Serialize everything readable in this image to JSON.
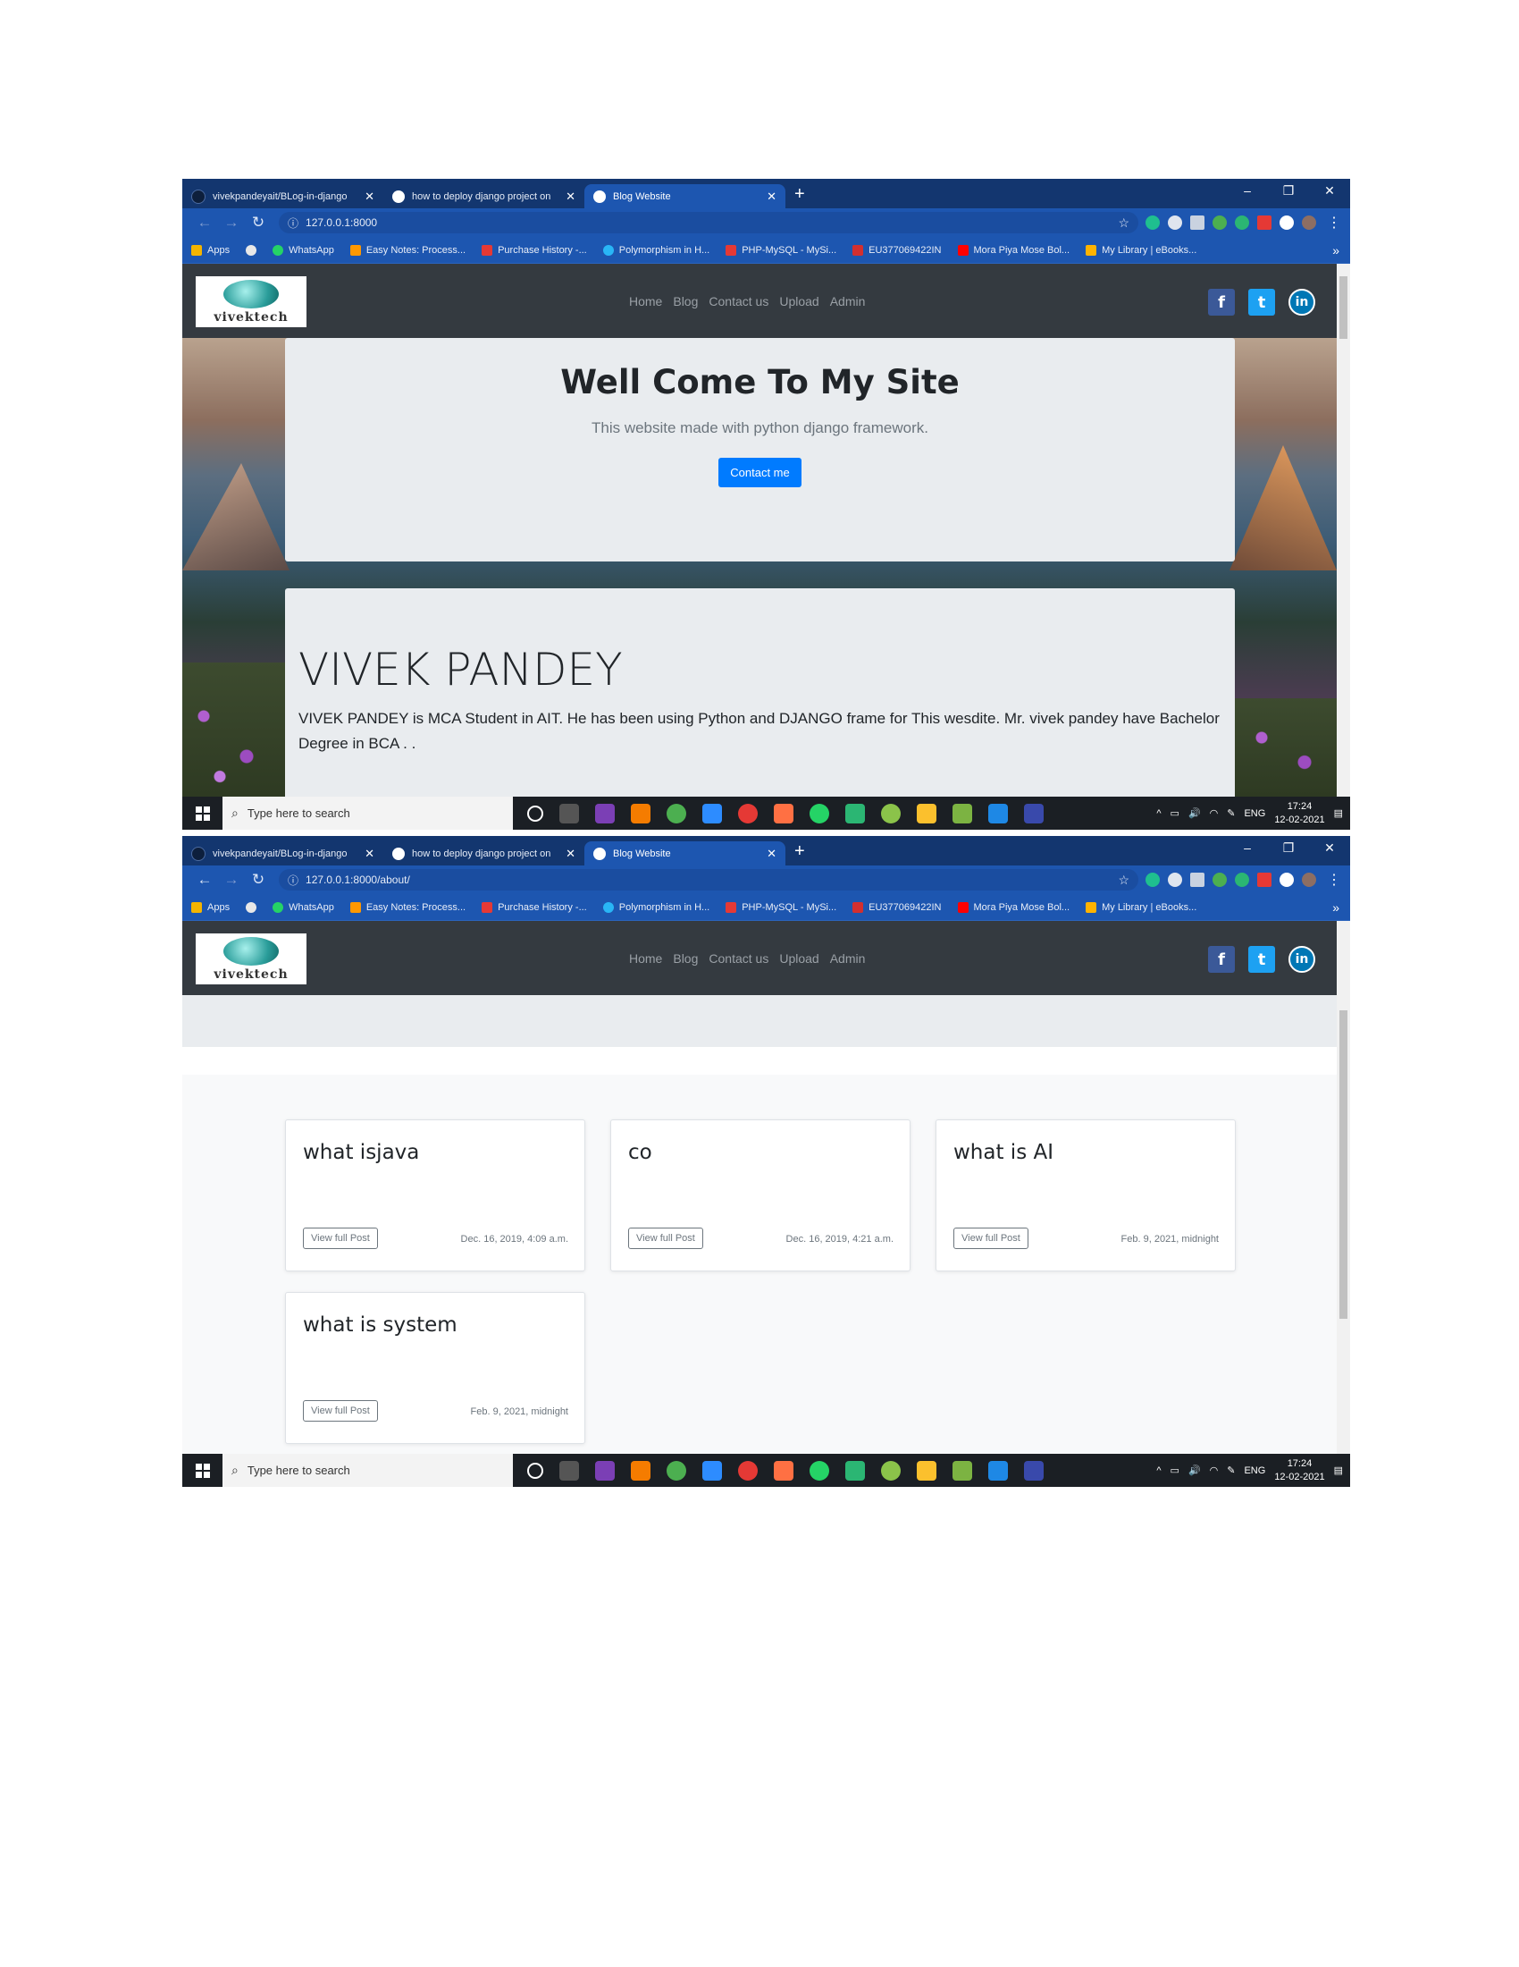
{
  "tabs": [
    {
      "title": "vivekpandeyait/BLog-in-django",
      "active": false
    },
    {
      "title": "how to deploy django project on",
      "active": false
    },
    {
      "title": "Blog Website",
      "active": true
    }
  ],
  "bookmarks": [
    "Apps",
    "WhatsApp",
    "Easy Notes: Process...",
    "Purchase History -...",
    "Polymorphism in H...",
    "PHP-MySQL - MySi...",
    "EU377069422IN",
    "Mora Piya Mose Bol...",
    "My Library | eBooks..."
  ],
  "site": {
    "logo_text": "vivektech",
    "nav": [
      "Home",
      "Blog",
      "Contact us",
      "Upload",
      "Admin"
    ],
    "social": {
      "facebook": "f",
      "twitter": "t",
      "linkedin": "in"
    }
  },
  "screen1": {
    "url": "127.0.0.1:8000",
    "hero_title": "Well Come To My Site",
    "hero_subtitle": "This website made with python django framework.",
    "hero_button": "Contact me",
    "about_title": "VIVEK PANDEY",
    "about_text": "VIVEK PANDEY is MCA Student in AIT. He has been using Python and DJANGO frame for This wesdite. Mr. vivek pandey have Bachelor Degree in BCA . ."
  },
  "screen2": {
    "url": "127.0.0.1:8000/about/",
    "posts": [
      {
        "title": "what isjava",
        "button": "View full Post",
        "date": "Dec. 16, 2019, 4:09 a.m."
      },
      {
        "title": "co",
        "button": "View full Post",
        "date": "Dec. 16, 2019, 4:21 a.m."
      },
      {
        "title": "what is AI",
        "button": "View full Post",
        "date": "Feb. 9, 2021, midnight"
      },
      {
        "title": "what is system",
        "button": "View full Post",
        "date": "Feb. 9, 2021, midnight"
      }
    ]
  },
  "taskbar": {
    "search_placeholder": "Type here to search",
    "lang": "ENG",
    "time": "17:24",
    "date": "12-02-2021"
  },
  "colors": {
    "chrome_tabstrip": "#13366f",
    "chrome_toolbar": "#1d56b0",
    "navbar": "#343a40",
    "jumbotron": "#e9ecef",
    "primary": "#007bff"
  }
}
